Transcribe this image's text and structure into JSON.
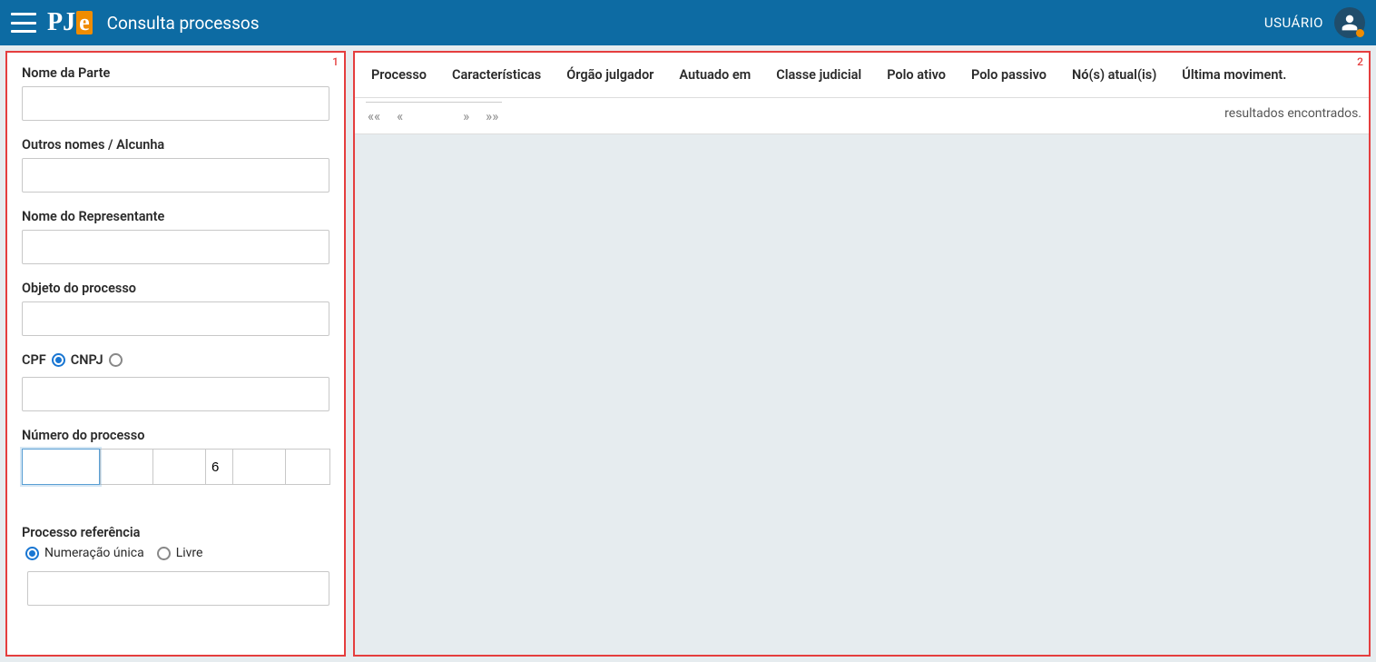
{
  "header": {
    "logo_p": "PJ",
    "logo_e": "e",
    "title": "Consulta processos",
    "user_label": "USUÁRIO"
  },
  "annotations": {
    "left": "1",
    "right": "2"
  },
  "form": {
    "nome_parte": {
      "label": "Nome da Parte",
      "value": ""
    },
    "outros_nomes": {
      "label": "Outros nomes / Alcunha",
      "value": ""
    },
    "nome_representante": {
      "label": "Nome do Representante",
      "value": ""
    },
    "objeto_processo": {
      "label": "Objeto do processo",
      "value": ""
    },
    "doc_type": {
      "cpf_label": "CPF",
      "cnpj_label": "CNPJ",
      "selected": "cpf",
      "value": ""
    },
    "numero_processo": {
      "label": "Número do processo",
      "p1": "",
      "p2": "",
      "p3": "",
      "p4": "6",
      "p5": "",
      "p6": ""
    },
    "processo_ref": {
      "label": "Processo referência",
      "opt_unica": "Numeração única",
      "opt_livre": "Livre",
      "selected": "unica",
      "value": ""
    }
  },
  "results": {
    "columns": [
      "Processo",
      "Características",
      "Órgão julgador",
      "Autuado em",
      "Classe judicial",
      "Polo ativo",
      "Polo passivo",
      "Nó(s) atual(is)",
      "Última moviment."
    ],
    "pager": {
      "first": "««",
      "prev": "«",
      "next": "»",
      "last": "»»"
    },
    "footer_label": "resultados encontrados."
  }
}
